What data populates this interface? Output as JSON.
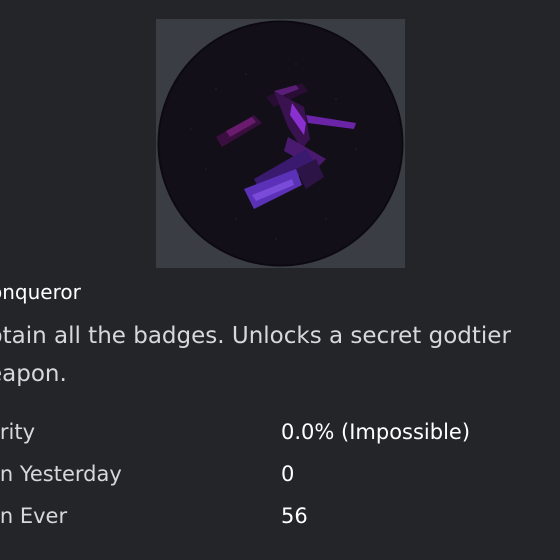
{
  "badge": {
    "image_icon": "badge-conqueror-image",
    "name": "onqueror",
    "description": "btain all the badges. Unlocks a secret godtier eapon."
  },
  "stats": [
    {
      "label": "arity",
      "value": "0.0% (Impossible)"
    },
    {
      "label": "on Yesterday",
      "value": "0"
    },
    {
      "label": "on Ever",
      "value": "56"
    }
  ],
  "colors": {
    "background": "#232529",
    "image_frame": "#3b3d45",
    "badge_circle": "#14101a",
    "accent_purple": "#7b22c9"
  }
}
